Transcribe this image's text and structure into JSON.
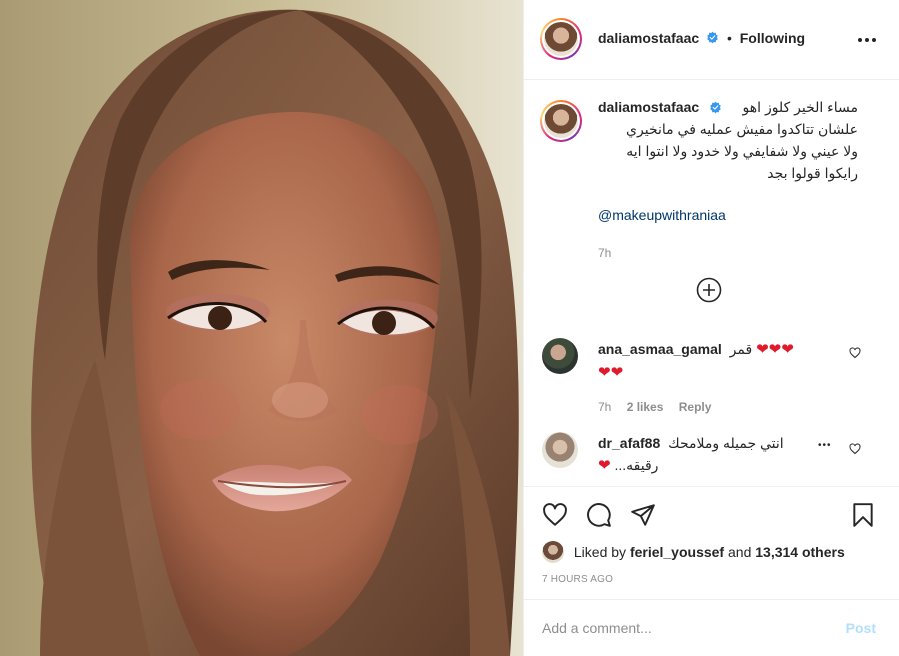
{
  "post": {
    "image_alt": "Portrait of a woman with long brown hair and pink makeup"
  },
  "header": {
    "username": "daliamostafaac",
    "separator": "•",
    "follow_status": "Following",
    "more_icon": "more-options-icon"
  },
  "caption": {
    "username": "daliamostafaac",
    "lines": [
      "مساء الخير كلوز اهو",
      "علشان تتاكدوا مفيش عمليه في مانخيري",
      "ولا عيني ولا شفايفي ولا خدود ولا انتوا ايه",
      "رايكوا قولوا بجد"
    ],
    "mention": "@makeupwithraniaa",
    "time": "7h"
  },
  "load_more_icon": "plus-circle-icon",
  "comments": [
    {
      "username": "ana_asmaa_gamal",
      "text": "قمر",
      "hearts_line1": "❤❤❤",
      "hearts_line2": "❤❤",
      "time": "7h",
      "likes": "2 likes",
      "reply": "Reply"
    },
    {
      "username": "dr_afaf88",
      "text": "انتي جميله وملامحك",
      "text_line2": "...رقيقه",
      "hearts": "❤",
      "more": "•••"
    }
  ],
  "actions": {
    "like_icon": "heart-icon",
    "comment_icon": "comment-icon",
    "share_icon": "paper-plane-icon",
    "save_icon": "bookmark-icon"
  },
  "likes": {
    "prefix": "Liked by",
    "user": "feriel_youssef",
    "conjunction": "and",
    "count": "13,314 others"
  },
  "timestamp": "7 HOURS AGO",
  "comment_box": {
    "placeholder": "Add a comment...",
    "post_label": "Post"
  },
  "colors": {
    "accent_link": "#00376b",
    "verified_blue": "#3897f0",
    "heart_red": "#e0192c",
    "post_button_disabled": "#b2dffc",
    "muted_text": "#8e8e8e"
  }
}
